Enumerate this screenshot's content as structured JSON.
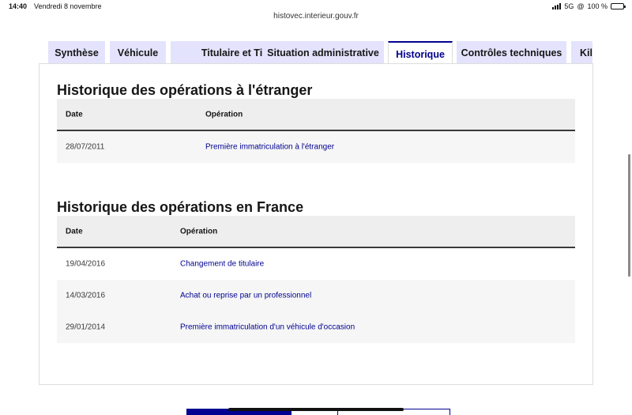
{
  "status_bar": {
    "time": "14:40",
    "date": "Vendredi 8 novembre",
    "network": "5G",
    "battery": "100 %",
    "battery_level": 1.0
  },
  "url": "histovec.interieur.gouv.fr",
  "tabs": [
    {
      "label": "Synthèse",
      "active": false
    },
    {
      "label": "Véhicule",
      "active": false
    },
    {
      "label": "Titulaire et Titre",
      "active": false
    },
    {
      "label": "Situation administrative",
      "active": false
    },
    {
      "label": "Historique",
      "active": true
    },
    {
      "label": "Contrôles techniques",
      "active": false
    },
    {
      "label": "Kilo",
      "active": false
    }
  ],
  "sections": [
    {
      "title": "Historique des opérations à l'étranger",
      "columns": [
        "Date",
        "Opération"
      ],
      "rows": [
        {
          "date": "28/07/2011",
          "operation": "Première immatriculation à l'étranger"
        }
      ]
    },
    {
      "title": "Historique des opérations en France",
      "columns": [
        "Date",
        "Opération"
      ],
      "rows": [
        {
          "date": "19/04/2016",
          "operation": "Changement de titulaire"
        },
        {
          "date": "14/03/2016",
          "operation": "Achat ou reprise par un professionnel"
        },
        {
          "date": "29/01/2014",
          "operation": "Première immatriculation d'un véhicule d'occasion"
        }
      ]
    }
  ],
  "colors": {
    "accent": "#000091",
    "tab_bg": "#e3e3fd",
    "header_bg": "#eeeeee",
    "row_alt_bg": "#f6f6f6"
  }
}
